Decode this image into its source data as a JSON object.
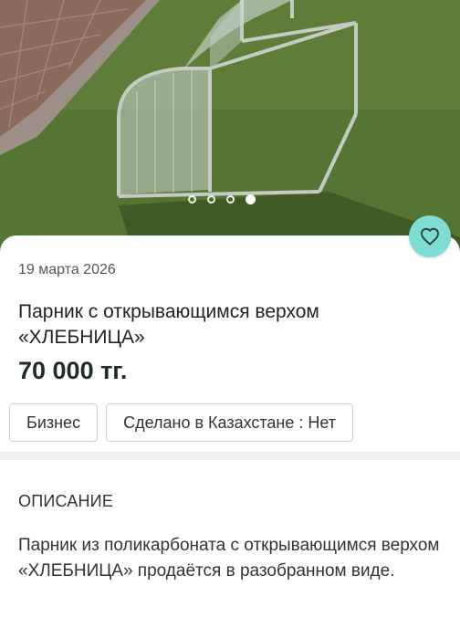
{
  "listing": {
    "date": "19 марта 2026",
    "title": "Парник с открывающимся верхом «ХЛЕБНИЦА»",
    "price": "70 000 тг."
  },
  "gallery": {
    "image_description": "greenhouse-photo",
    "total_images": 4,
    "active_index": 3
  },
  "chips": [
    {
      "label": "Бизнес"
    },
    {
      "label": "Сделано в Казахстане : Нет"
    }
  ],
  "description": {
    "heading": "ОПИСАНИЕ",
    "text": "Парник из поликарбоната с открывающимся верхом «ХЛЕБНИЦА» продаётся в разобранном виде."
  },
  "colors": {
    "favorite_button": "#7fdcd2",
    "price_text": "#1f2b2a"
  },
  "icons": {
    "favorite": "heart-icon"
  }
}
